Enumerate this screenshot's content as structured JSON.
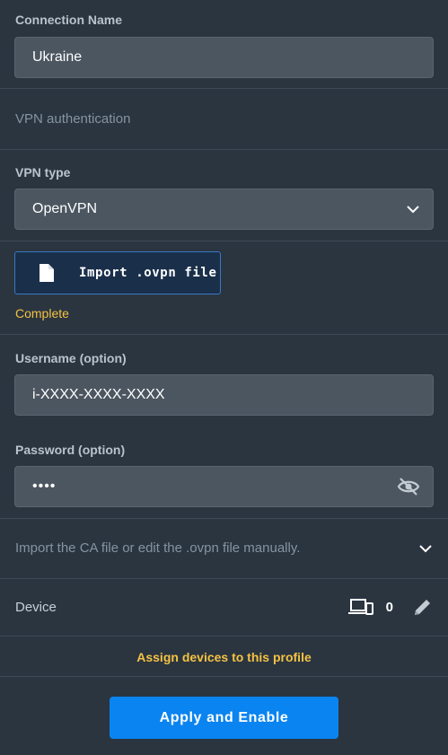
{
  "connection": {
    "label": "Connection Name",
    "value": "Ukraine"
  },
  "auth_heading": "VPN authentication",
  "vpn_type": {
    "label": "VPN type",
    "value": "OpenVPN"
  },
  "import": {
    "button_label": "Import .ovpn file",
    "status": "Complete",
    "status_color": "#f5c242"
  },
  "username": {
    "label": "Username (option)",
    "value": "i-XXXX-XXXX-XXXX"
  },
  "password": {
    "label": "Password (option)",
    "value": "••••"
  },
  "ca_section": {
    "text": "Import the CA file or edit the .ovpn file manually."
  },
  "device": {
    "label": "Device",
    "count": "0"
  },
  "assign_link": "Assign devices to this profile",
  "apply_button": "Apply and Enable",
  "colors": {
    "background": "#2a3540",
    "field": "#4b5660",
    "accent": "#0a84f0",
    "highlight": "#f5c242"
  }
}
